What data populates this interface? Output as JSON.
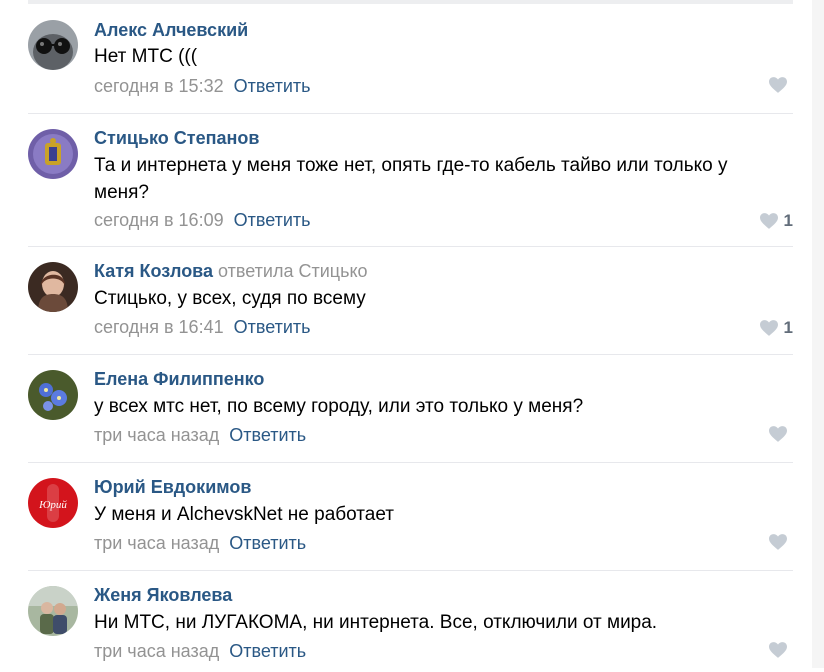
{
  "comments": [
    {
      "author": "Алекс Алчевский",
      "text": "Нет МТС (((",
      "time": "сегодня в 15:32",
      "reply_label": "Ответить",
      "likes": ""
    },
    {
      "author": "Стицько Степанов",
      "text": "Та и интернета у меня тоже нет, опять где-то кабель тайво или только у меня?",
      "time": "сегодня в 16:09",
      "reply_label": "Ответить",
      "likes": "1"
    },
    {
      "author": "Катя Козлова",
      "reply_to": "ответила Стицько",
      "text": "Стицько, у всех, судя по всему",
      "time": "сегодня в 16:41",
      "reply_label": "Ответить",
      "likes": "1"
    },
    {
      "author": "Елена Филиппенко",
      "text": "у всех мтс нет, по всему городу, или это только у меня?",
      "time": "три часа назад",
      "reply_label": "Ответить",
      "likes": ""
    },
    {
      "author": "Юрий Евдокимов",
      "text": "У меня и AlchevskNet не работает",
      "time": "три часа назад",
      "reply_label": "Ответить",
      "likes": ""
    },
    {
      "author": "Женя Яковлева",
      "text": "Ни МТС, ни ЛУГАКОМА, ни интернета. Все, отключили от мира.",
      "time": "три часа назад",
      "reply_label": "Ответить",
      "likes": ""
    }
  ],
  "avatar_badge_text": "Юрий",
  "icons": {
    "like": "heart-icon"
  },
  "colors": {
    "link": "#2a5885",
    "muted": "#939393",
    "separator": "#e7e8ec"
  }
}
